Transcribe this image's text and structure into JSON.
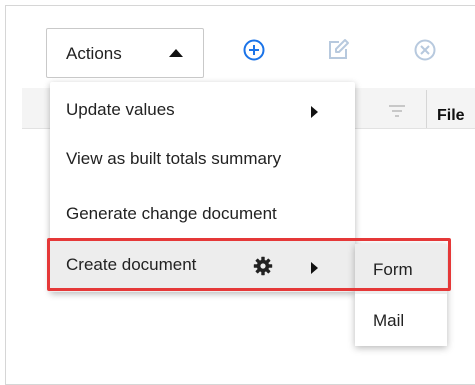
{
  "toolbar": {
    "actions_label": "Actions",
    "icons": [
      "caret-up-icon",
      "add-circle-icon",
      "edit-icon",
      "cancel-circle-icon"
    ]
  },
  "table": {
    "column_header": "File",
    "icons": [
      "filter-icon"
    ]
  },
  "actions_menu": {
    "items": [
      {
        "label": "Update values",
        "has_submenu": true
      },
      {
        "label": "View as built totals summary"
      },
      {
        "label": "Generate change document"
      },
      {
        "label": "Create document",
        "has_submenu": true,
        "icon": "gear-icon",
        "highlighted": true
      }
    ]
  },
  "create_document_submenu": {
    "items": [
      {
        "label": "Form",
        "hovered": true
      },
      {
        "label": "Mail"
      }
    ]
  },
  "colors": {
    "accent": "#1a73e8",
    "highlight_border": "#e53838",
    "hover_bg": "#ededed",
    "disabled_icon": "#b7c9de"
  }
}
